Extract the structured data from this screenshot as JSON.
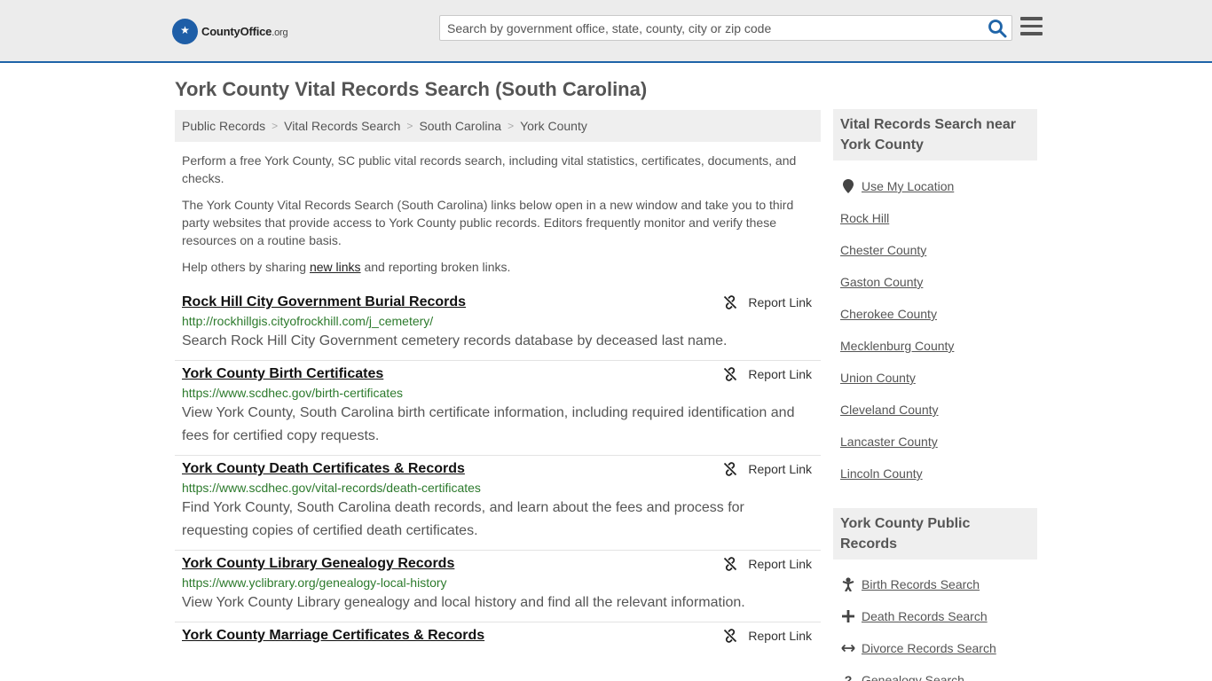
{
  "header": {
    "logo_name": "CountyOffice",
    "logo_tld": ".org",
    "search_placeholder": "Search by government office, state, county, city or zip code"
  },
  "page": {
    "title": "York County Vital Records Search (South Carolina)"
  },
  "breadcrumb": [
    "Public Records",
    "Vital Records Search",
    "South Carolina",
    "York County"
  ],
  "intro": {
    "p1": "Perform a free York County, SC public vital records search, including vital statistics, certificates, documents, and checks.",
    "p2": "The York County Vital Records Search (South Carolina) links below open in a new window and take you to third party websites that provide access to York County public records. Editors frequently monitor and verify these resources on a routine basis.",
    "p3_before": "Help others by sharing ",
    "p3_link": "new links",
    "p3_after": " and reporting broken links."
  },
  "report_label": "Report Link",
  "records": [
    {
      "title": "Rock Hill City Government Burial Records",
      "url": "http://rockhillgis.cityofrockhill.com/j_cemetery/",
      "desc": "Search Rock Hill City Government cemetery records database by deceased last name."
    },
    {
      "title": "York County Birth Certificates",
      "url": "https://www.scdhec.gov/birth-certificates",
      "desc": "View York County, South Carolina birth certificate information, including required identification and fees for certified copy requests."
    },
    {
      "title": "York County Death Certificates & Records",
      "url": "https://www.scdhec.gov/vital-records/death-certificates",
      "desc": "Find York County, South Carolina death records, and learn about the fees and process for requesting copies of certified death certificates."
    },
    {
      "title": "York County Library Genealogy Records",
      "url": "https://www.yclibrary.org/genealogy-local-history",
      "desc": "View York County Library genealogy and local history and find all the relevant information."
    },
    {
      "title": "York County Marriage Certificates & Records",
      "url": "",
      "desc": ""
    }
  ],
  "sidebar": {
    "nearby_heading": "Vital Records Search near York County",
    "use_location": "Use My Location",
    "nearby": [
      "Rock Hill",
      "Chester County",
      "Gaston County",
      "Cherokee County",
      "Mecklenburg County",
      "Union County",
      "Cleveland County",
      "Lancaster County",
      "Lincoln County"
    ],
    "public_heading": "York County Public Records",
    "public_links": [
      {
        "label": "Birth Records Search",
        "icon": "baby-icon"
      },
      {
        "label": "Death Records Search",
        "icon": "cross-icon"
      },
      {
        "label": "Divorce Records Search",
        "icon": "split-arrows-icon"
      },
      {
        "label": "Genealogy Search",
        "icon": "question-icon"
      }
    ]
  }
}
